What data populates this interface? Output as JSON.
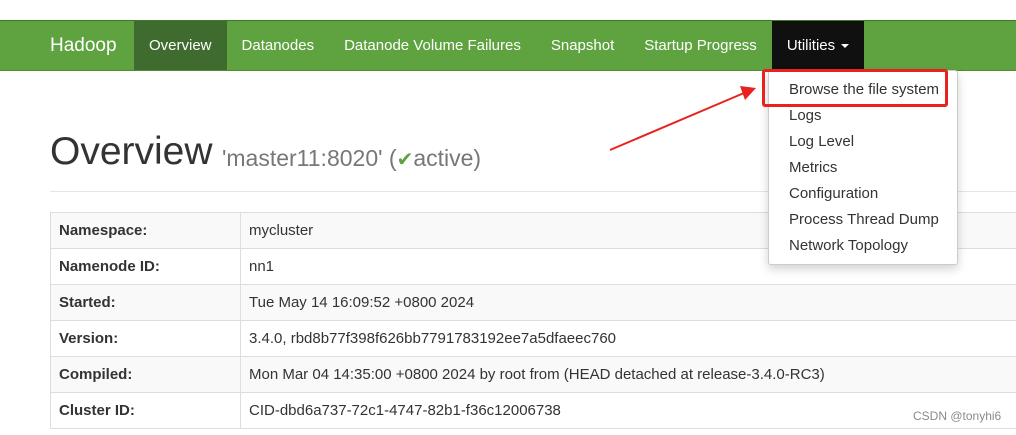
{
  "navbar": {
    "brand": "Hadoop",
    "items": [
      {
        "label": "Overview"
      },
      {
        "label": "Datanodes"
      },
      {
        "label": "Datanode Volume Failures"
      },
      {
        "label": "Snapshot"
      },
      {
        "label": "Startup Progress"
      },
      {
        "label": "Utilities"
      }
    ],
    "accent_color": "#5fa341"
  },
  "header": {
    "title": "Overview",
    "subtitle_prefix": "'master11:8020' (",
    "status_icon": "checkmark-icon",
    "status": "active",
    "subtitle_suffix": ")"
  },
  "info_table": [
    {
      "key": "Namespace:",
      "value": "mycluster"
    },
    {
      "key": "Namenode ID:",
      "value": "nn1"
    },
    {
      "key": "Started:",
      "value": "Tue May 14 16:09:52 +0800 2024"
    },
    {
      "key": "Version:",
      "value": "3.4.0, rbd8b77f398f626bb7791783192ee7a5dfaeec760"
    },
    {
      "key": "Compiled:",
      "value": "Mon Mar 04 14:35:00 +0800 2024 by root from (HEAD detached at release-3.4.0-RC3)"
    },
    {
      "key": "Cluster ID:",
      "value": "CID-dbd6a737-72c1-4747-82b1-f36c12006738"
    }
  ],
  "utilities_menu": [
    {
      "label": "Browse the file system"
    },
    {
      "label": "Logs"
    },
    {
      "label": "Log Level"
    },
    {
      "label": "Metrics"
    },
    {
      "label": "Configuration"
    },
    {
      "label": "Process Thread Dump"
    },
    {
      "label": "Network Topology"
    }
  ],
  "annotation_color": "#e8231f",
  "watermark": "CSDN @tonyhi6"
}
